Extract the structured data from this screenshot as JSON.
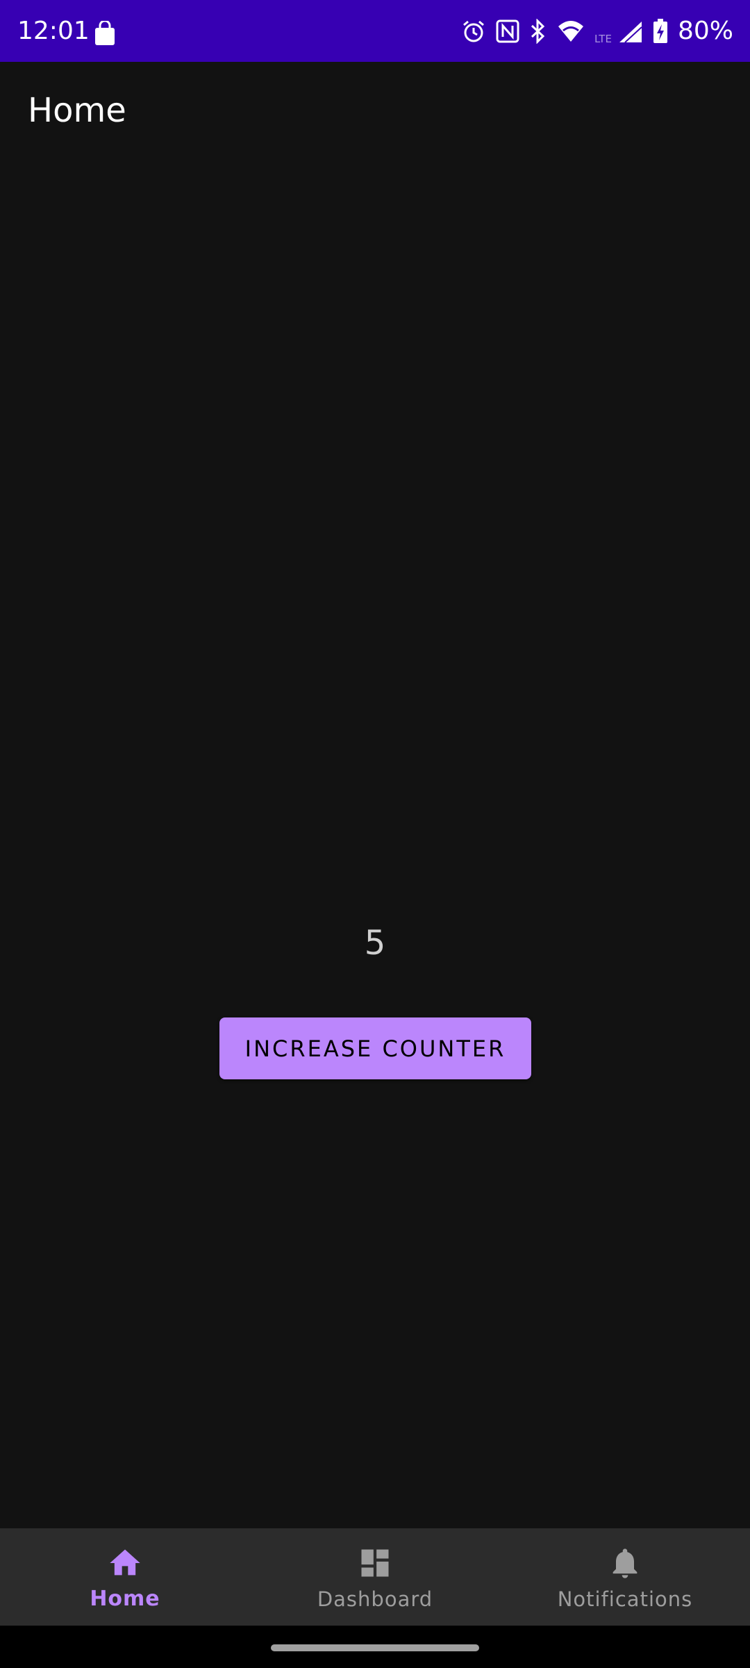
{
  "status_bar": {
    "time": "12:01",
    "battery_percent": "80%",
    "background_color": "#3700b3",
    "icons": [
      "shopping-bag-icon",
      "alarm-icon",
      "nfc-icon",
      "bluetooth-icon",
      "wifi-icon",
      "lte-signal-icon",
      "battery-charging-icon"
    ]
  },
  "toolbar": {
    "title": "Home"
  },
  "main": {
    "counter_value": "5",
    "increase_button_label": "INCREASE COUNTER"
  },
  "bottom_nav": {
    "items": [
      {
        "label": "Home",
        "icon": "home-icon",
        "selected": true
      },
      {
        "label": "Dashboard",
        "icon": "dashboard-icon",
        "selected": false
      },
      {
        "label": "Notifications",
        "icon": "bell-icon",
        "selected": false
      }
    ]
  },
  "colors": {
    "accent": "#bb86fc",
    "background": "#121212",
    "nav_background": "#2c2c2c",
    "inactive": "#9e9e9e"
  }
}
